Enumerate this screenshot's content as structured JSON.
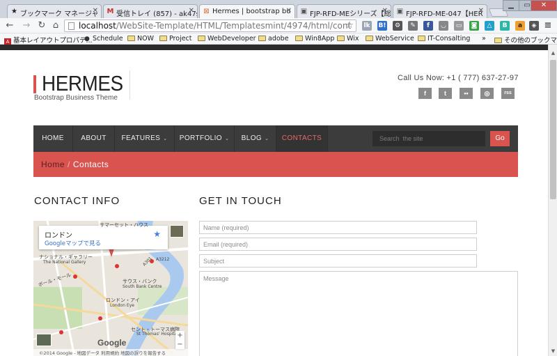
{
  "browser": {
    "tabs": [
      {
        "label": "ブックマーク マネージャ",
        "icon": "★"
      },
      {
        "label": "受信トレイ (857) - ak47s",
        "icon": "M"
      },
      {
        "label": "Hermes | bootstrap bu",
        "icon": "⊠"
      },
      {
        "label": "FJP-RFD-MEシリーズ【総",
        "icon": "▣"
      },
      {
        "label": "FJP-RFD-ME-047【HER",
        "icon": "▣"
      }
    ],
    "url_host": "localhost",
    "url_path": "/WebSite-Template/HTML/Templatesmint/4974/html/cont",
    "bookmarks": [
      {
        "label": "基本レイアウトプロパテ...",
        "type": "pdf"
      },
      {
        "label": "Schedule",
        "type": "apple"
      },
      {
        "label": "NOW",
        "type": "folder"
      },
      {
        "label": "Project",
        "type": "folder"
      },
      {
        "label": "WebDeveloper",
        "type": "folder"
      },
      {
        "label": "adobe",
        "type": "folder"
      },
      {
        "label": "Win8App",
        "type": "folder"
      },
      {
        "label": "Wix",
        "type": "folder"
      },
      {
        "label": "WebService",
        "type": "folder"
      },
      {
        "label": "IT-Consalting",
        "type": "folder"
      },
      {
        "label": "その他のブックマーク",
        "type": "folder"
      }
    ],
    "bookmarks_more": "»"
  },
  "site": {
    "logo": "HERMES",
    "tagline": "Bootstrap Business Theme",
    "call_us": "Call Us Now: +1 ( 777) 637-27-97",
    "social": [
      "f",
      "t",
      "••",
      "◎",
      "rss"
    ],
    "nav": [
      {
        "label": "HOME",
        "caret": ""
      },
      {
        "label": "ABOUT",
        "caret": ""
      },
      {
        "label": "FEATURES",
        "caret": "⌄"
      },
      {
        "label": "PORTFOLIO",
        "caret": "⌄"
      },
      {
        "label": "BLOG",
        "caret": "⌄"
      },
      {
        "label": "CONTACTS",
        "caret": ""
      }
    ],
    "search_placeholder": "Search  the site",
    "search_button": "Go",
    "breadcrumb_home": "Home",
    "breadcrumb_sep": "/",
    "breadcrumb_current": "Contacts",
    "contact_title": "CONTACT INFO",
    "touch_title": "GET IN TOUCH",
    "map": {
      "city": "ロンドン",
      "link": "Googleマップで見る",
      "labels": [
        "サマーセット・ハウス",
        "ナショナル・ギャラリー",
        "The National Gallery",
        "ボール・モール",
        "サウス・バンク",
        "South Bank Centre",
        "ロンドン・アイ",
        "London Eye",
        "セント・トーマス病院",
        "St Thomas' Hospital",
        "A301",
        "A3212"
      ],
      "brand": "Google",
      "zoom_in": "+",
      "zoom_out": "−",
      "credit": "©2014 Google - 地図データ   利用規約   地図の誤りを報告する"
    },
    "form": {
      "name_placeholder": "Name (required)",
      "email_placeholder": "Email (required)",
      "subject_placeholder": "Subject",
      "message_placeholder": "Message"
    }
  },
  "colors": {
    "accent": "#d9534f",
    "nav_bg": "#3c3c3c"
  }
}
